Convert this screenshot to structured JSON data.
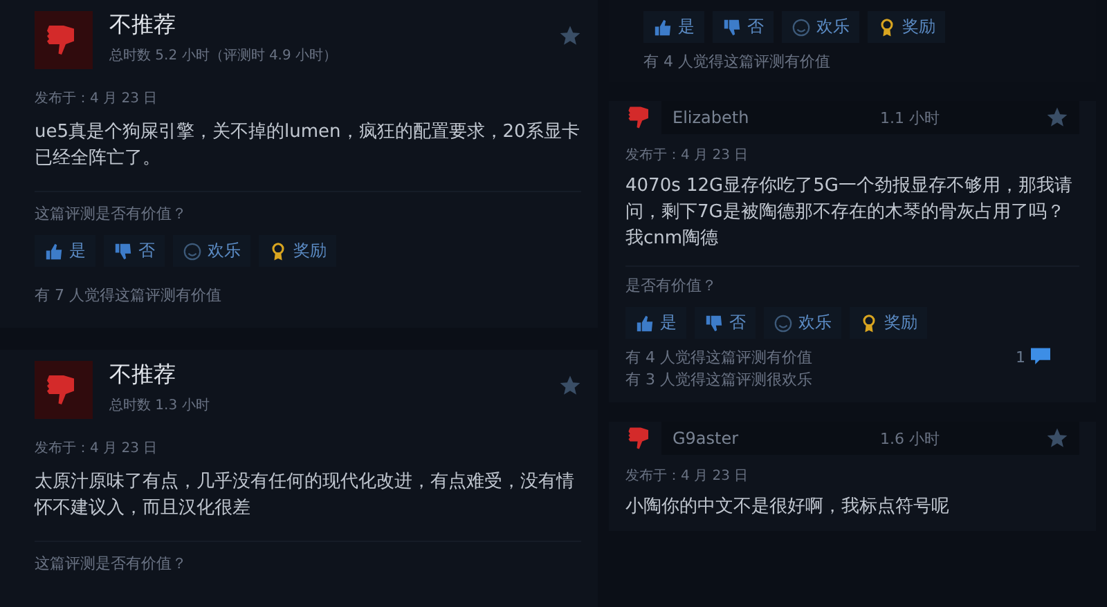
{
  "columns": [
    {
      "reviews": [
        {
          "kind": "full",
          "title": "不推荐",
          "playtime": "总时数 5.2 小时（评测时 4.9 小时）",
          "date": "发布于：4 月 23 日",
          "text": "ue5真是个狗屎引擎，关不掉的lumen，疯狂的配置要求，20系显卡已经全阵亡了。",
          "question": "这篇评测是否有价值？",
          "buttons": [
            {
              "kind": "yes",
              "label": "是"
            },
            {
              "kind": "no",
              "label": "否"
            },
            {
              "kind": "funny",
              "label": "欢乐"
            },
            {
              "kind": "award",
              "label": "奖励"
            }
          ],
          "helpful": [
            "有 7 人觉得这篇评测有价值"
          ]
        },
        {
          "kind": "full",
          "title": "不推荐",
          "playtime": "总时数 1.3 小时",
          "date": "发布于：4 月 23 日",
          "text": "太原汁原味了有点，几乎没有任何的现代化改进，有点难受，没有情怀不建议入，而且汉化很差",
          "question": "这篇评测是否有价值？"
        }
      ]
    },
    {
      "reviews": [
        {
          "kind": "fragment",
          "buttons": [
            {
              "kind": "yes",
              "label": "是"
            },
            {
              "kind": "no",
              "label": "否"
            },
            {
              "kind": "funny",
              "label": "欢乐"
            },
            {
              "kind": "award",
              "label": "奖励"
            }
          ],
          "helpful": [
            "有 4 人觉得这篇评测有价值"
          ]
        },
        {
          "kind": "compact",
          "title": "Elizabeth",
          "playtime": "1.1 小时",
          "date": "发布于：4 月 23 日",
          "text": "4070s 12G显存你吃了5G一个劲报显存不够用，那我请问，剩下7G是被陶德那不存在的木琴的骨灰占用了吗？我cnm陶德",
          "question": "是否有价值？",
          "buttons": [
            {
              "kind": "yes",
              "label": "是"
            },
            {
              "kind": "no",
              "label": "否"
            },
            {
              "kind": "funny",
              "label": "欢乐"
            },
            {
              "kind": "award",
              "label": "奖励"
            }
          ],
          "helpful": [
            "有 4 人觉得这篇评测有价值",
            "有 3 人觉得这篇评测很欢乐"
          ],
          "comments": "1"
        },
        {
          "kind": "compact",
          "title": "G9aster",
          "playtime": "1.6 小时",
          "date": "发布于：4 月 23 日",
          "text": "小陶你的中文不是很好啊，我标点符号呢"
        }
      ]
    }
  ]
}
